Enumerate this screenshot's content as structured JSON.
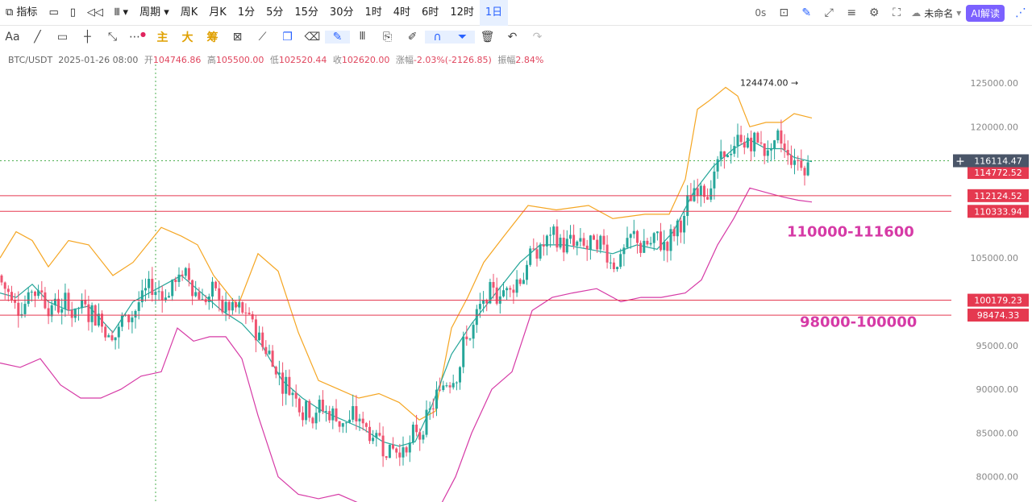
{
  "toolbar": {
    "indicator": "指标",
    "period_menu": "周期",
    "periods": [
      "周K",
      "月K",
      "1分",
      "5分",
      "15分",
      "30分",
      "1时",
      "4时",
      "6时",
      "12时",
      "1日"
    ],
    "active_period": "1日",
    "countdown": "0s",
    "layout_name": "未命名",
    "ai_label": "AI解读"
  },
  "drawtools": {
    "font_label": "Aa",
    "main_label": "主",
    "big_label": "大",
    "chip_label": "筹"
  },
  "legend": {
    "symbol": "BTC/USDT",
    "date": "2025-01-26 08:00",
    "open_label": "开",
    "open": "104746.86",
    "high_label": "高",
    "high": "105500.00",
    "low_label": "低",
    "low": "102520.44",
    "close_label": "收",
    "close": "102620.00",
    "change_label": "涨幅",
    "change": "-2.03%(-2126.85)",
    "amp_label": "振幅",
    "amp": "2.84%"
  },
  "chart_data": {
    "type": "candlestick",
    "symbol": "BTC/USDT",
    "y_ticks": [
      125000,
      120000,
      105000,
      95000,
      90000,
      85000,
      80000
    ],
    "y_tick_labels": [
      "125000.00",
      "120000.00",
      "105000.00",
      "95000.00",
      "90000.00",
      "85000.00",
      "80000.00"
    ],
    "ylim": [
      77000,
      130500
    ],
    "peak_label": "124474.00",
    "peak_value": 124474,
    "crosshair_price": "116114.47",
    "price_tags": [
      {
        "value": 114772.52,
        "label": "114772.52"
      },
      {
        "value": 112124.52,
        "label": "112124.52"
      },
      {
        "value": 110333.94,
        "label": "110333.94"
      },
      {
        "value": 100179.23,
        "label": "100179.23"
      },
      {
        "value": 98474.33,
        "label": "98474.33"
      }
    ],
    "horizontal_lines": [
      112124.52,
      110333.94,
      100179.23,
      98474.33
    ],
    "zones": [
      {
        "label": "110000-111600",
        "value": 108000
      },
      {
        "label": "98000-100000",
        "value": 97700
      }
    ],
    "series": [
      {
        "name": "upper",
        "color": "#f5a623",
        "points": [
          [
            0,
            105000
          ],
          [
            20,
            108000
          ],
          [
            40,
            107000
          ],
          [
            60,
            104000
          ],
          [
            85,
            107000
          ],
          [
            110,
            106500
          ],
          [
            140,
            103000
          ],
          [
            165,
            104500
          ],
          [
            200,
            108500
          ],
          [
            225,
            107500
          ],
          [
            245,
            106500
          ],
          [
            265,
            103000
          ],
          [
            295,
            99500
          ],
          [
            320,
            105500
          ],
          [
            345,
            103500
          ],
          [
            370,
            96500
          ],
          [
            395,
            91000
          ],
          [
            420,
            90000
          ],
          [
            445,
            89000
          ],
          [
            470,
            89500
          ],
          [
            495,
            88500
          ],
          [
            520,
            86500
          ],
          [
            540,
            87500
          ],
          [
            560,
            97000
          ],
          [
            580,
            100500
          ],
          [
            600,
            104500
          ],
          [
            625,
            107500
          ],
          [
            655,
            111000
          ],
          [
            690,
            110500
          ],
          [
            730,
            111000
          ],
          [
            760,
            109500
          ],
          [
            800,
            110000
          ],
          [
            830,
            110000
          ],
          [
            850,
            114000
          ],
          [
            865,
            122000
          ],
          [
            880,
            123000
          ],
          [
            900,
            124500
          ],
          [
            915,
            123500
          ],
          [
            930,
            120000
          ],
          [
            950,
            120500
          ],
          [
            970,
            120500
          ],
          [
            985,
            121500
          ],
          [
            1007,
            121000
          ]
        ]
      },
      {
        "name": "middle",
        "color": "#26a69a",
        "points": [
          [
            0,
            101000
          ],
          [
            20,
            100500
          ],
          [
            40,
            102000
          ],
          [
            60,
            100000
          ],
          [
            85,
            99000
          ],
          [
            110,
            99500
          ],
          [
            140,
            96500
          ],
          [
            165,
            100000
          ],
          [
            195,
            101500
          ],
          [
            225,
            103000
          ],
          [
            250,
            101000
          ],
          [
            275,
            99000
          ],
          [
            300,
            97500
          ],
          [
            325,
            95000
          ],
          [
            350,
            91000
          ],
          [
            375,
            89000
          ],
          [
            400,
            87500
          ],
          [
            425,
            86500
          ],
          [
            450,
            85500
          ],
          [
            475,
            84000
          ],
          [
            495,
            83500
          ],
          [
            515,
            84000
          ],
          [
            535,
            88000
          ],
          [
            560,
            94000
          ],
          [
            585,
            97500
          ],
          [
            615,
            101000
          ],
          [
            645,
            104500
          ],
          [
            670,
            106500
          ],
          [
            700,
            106500
          ],
          [
            730,
            106000
          ],
          [
            760,
            105500
          ],
          [
            790,
            106500
          ],
          [
            815,
            106000
          ],
          [
            835,
            108000
          ],
          [
            860,
            112500
          ],
          [
            885,
            115500
          ],
          [
            910,
            117500
          ],
          [
            930,
            118500
          ],
          [
            950,
            117500
          ],
          [
            970,
            117500
          ],
          [
            985,
            116500
          ],
          [
            1007,
            116000
          ]
        ]
      },
      {
        "name": "lower",
        "color": "#d63aa6",
        "points": [
          [
            0,
            93000
          ],
          [
            25,
            92500
          ],
          [
            50,
            93500
          ],
          [
            75,
            90500
          ],
          [
            100,
            89000
          ],
          [
            125,
            89000
          ],
          [
            150,
            90000
          ],
          [
            175,
            91500
          ],
          [
            200,
            92000
          ],
          [
            220,
            97000
          ],
          [
            240,
            95500
          ],
          [
            260,
            96000
          ],
          [
            280,
            96000
          ],
          [
            300,
            93500
          ],
          [
            320,
            87000
          ],
          [
            345,
            80000
          ],
          [
            370,
            78000
          ],
          [
            395,
            77500
          ],
          [
            420,
            78000
          ],
          [
            445,
            77000
          ],
          [
            470,
            77000
          ],
          [
            495,
            76500
          ],
          [
            515,
            77000
          ],
          [
            545,
            76500
          ],
          [
            565,
            80000
          ],
          [
            585,
            85000
          ],
          [
            610,
            90000
          ],
          [
            635,
            92000
          ],
          [
            660,
            99000
          ],
          [
            685,
            100500
          ],
          [
            710,
            101000
          ],
          [
            740,
            101500
          ],
          [
            770,
            100000
          ],
          [
            795,
            100500
          ],
          [
            820,
            100500
          ],
          [
            850,
            101000
          ],
          [
            870,
            102500
          ],
          [
            890,
            106500
          ],
          [
            910,
            109500
          ],
          [
            930,
            113000
          ],
          [
            950,
            112500
          ],
          [
            970,
            112000
          ],
          [
            990,
            111600
          ],
          [
            1007,
            111400
          ]
        ]
      }
    ]
  }
}
